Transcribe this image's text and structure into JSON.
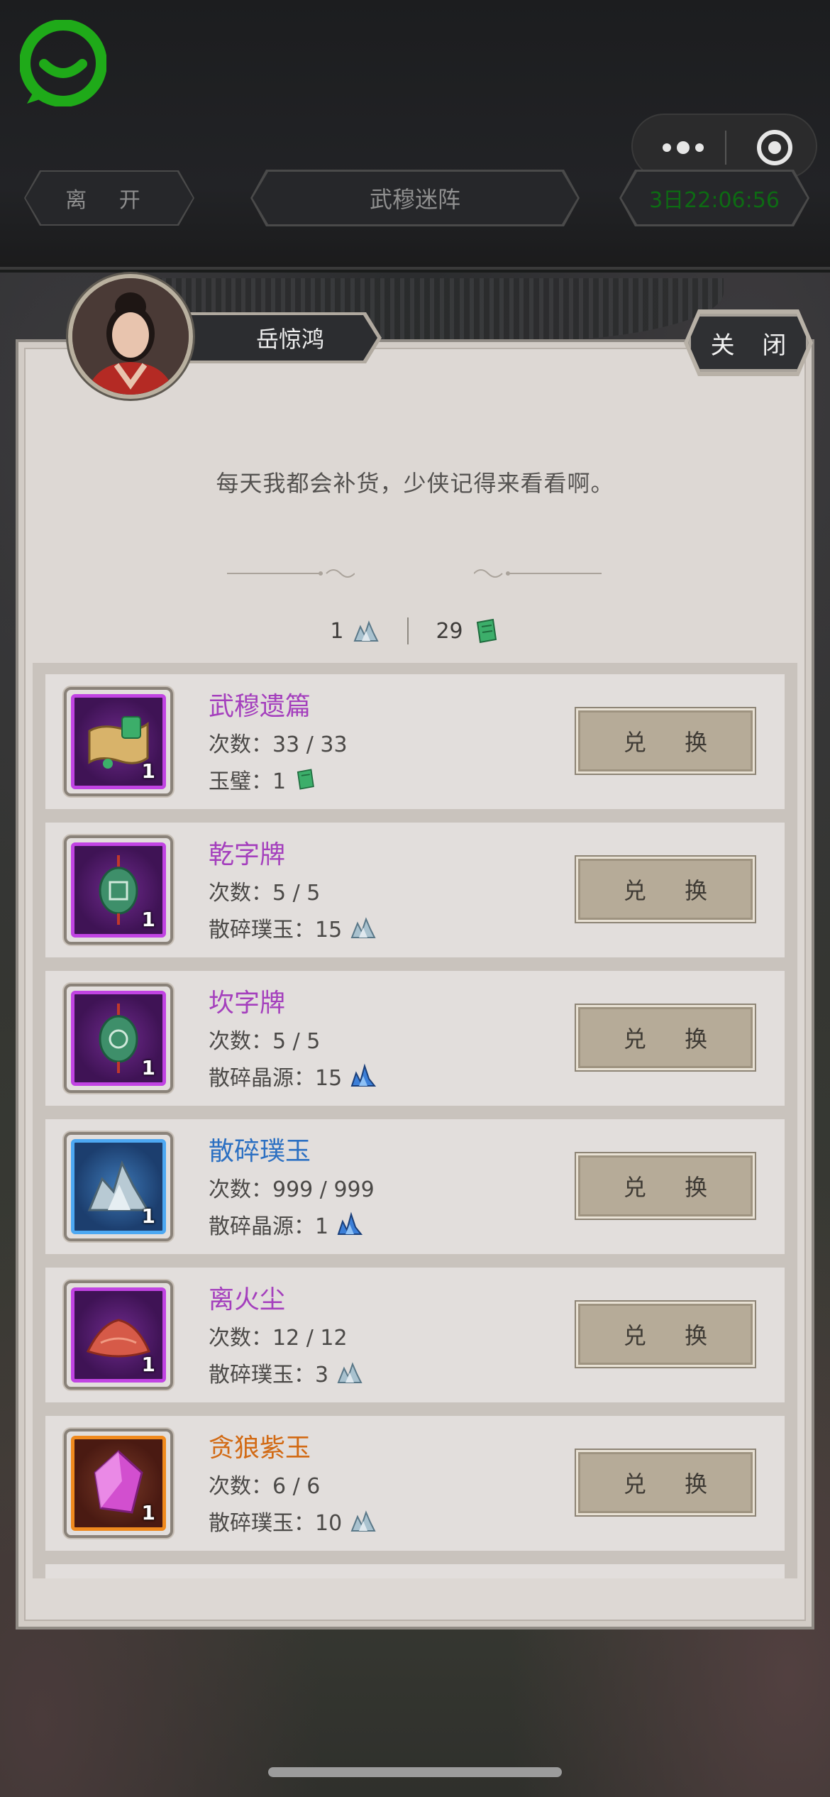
{
  "header": {
    "leave_label": "离 开",
    "title": "武穆迷阵",
    "time": "3日22:06:56"
  },
  "npc": {
    "name": "岳惊鸿",
    "speech": "每天我都会补货，少侠记得来看看啊。",
    "close_label": "关 闭"
  },
  "currency": [
    {
      "value": "1",
      "icon": "shattered-jade-icon"
    },
    {
      "value": "29",
      "icon": "jade-tablet-icon"
    }
  ],
  "items": [
    {
      "name": "武穆遗篇",
      "quality": "purple",
      "count": "次数：33 / 33",
      "cost_label": "玉璧：1",
      "cost_icon": "jade-tablet-icon",
      "qty": "1",
      "icon": "scroll-icon",
      "button": "兑 换"
    },
    {
      "name": "乾字牌",
      "quality": "purple",
      "count": "次数：5 / 5",
      "cost_label": "散碎璞玉：15",
      "cost_icon": "shattered-jade-icon",
      "qty": "1",
      "icon": "jade-pendant-icon",
      "button": "兑 换"
    },
    {
      "name": "坎字牌",
      "quality": "purple",
      "count": "次数：5 / 5",
      "cost_label": "散碎晶源：15",
      "cost_icon": "crystal-source-icon",
      "qty": "1",
      "icon": "jade-pendant-icon",
      "button": "兑 换"
    },
    {
      "name": "散碎璞玉",
      "quality": "blue",
      "count": "次数：999 / 999",
      "cost_label": "散碎晶源：1",
      "cost_icon": "crystal-source-icon",
      "qty": "1",
      "icon": "jade-ore-icon",
      "button": "兑 换"
    },
    {
      "name": "离火尘",
      "quality": "purple",
      "count": "次数：12 / 12",
      "cost_label": "散碎璞玉：3",
      "cost_icon": "shattered-jade-icon",
      "qty": "1",
      "icon": "dust-pile-icon",
      "button": "兑 换"
    },
    {
      "name": "贪狼紫玉",
      "quality": "orange",
      "count": "次数：6 / 6",
      "cost_label": "散碎璞玉：10",
      "cost_icon": "shattered-jade-icon",
      "qty": "1",
      "icon": "purple-gem-icon",
      "button": "兑 换"
    }
  ],
  "colors": {
    "purple_name": "#a43fbd",
    "blue_name": "#2c70c2",
    "orange_name": "#d26a14",
    "time_text": "#0d6b13",
    "app_logo": "#1faa19"
  }
}
